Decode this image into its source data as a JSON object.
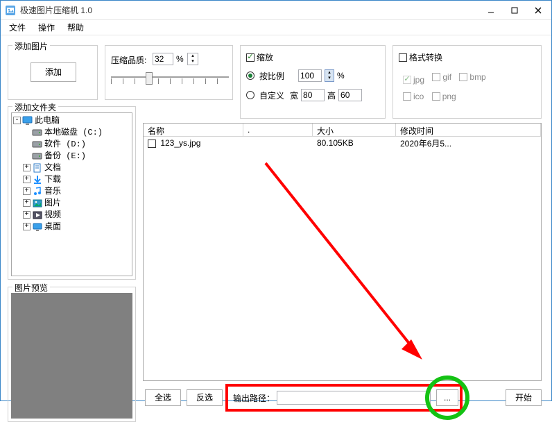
{
  "titlebar": {
    "title": "极速图片压缩机 1.0"
  },
  "menu": {
    "file": "文件",
    "action": "操作",
    "help": "帮助"
  },
  "panels": {
    "add": {
      "legend": "添加图片",
      "button": "添加"
    },
    "quality": {
      "label": "压缩品质:",
      "value": "32",
      "pct": "%"
    },
    "scale": {
      "check_label": "缩放",
      "checked": true,
      "by_ratio_label": "按比例",
      "by_ratio_selected": true,
      "ratio_value": "100",
      "ratio_pct": "%",
      "custom_label": "自定义",
      "custom_selected": false,
      "width_label": "宽",
      "width_value": "80",
      "height_label": "高",
      "height_value": "60"
    },
    "format": {
      "check_label": "格式转换",
      "checked": false,
      "items": [
        "jpg",
        "gif",
        "bmp",
        "ico",
        "png"
      ]
    },
    "tree": {
      "legend": "添加文件夹",
      "root": "此电脑",
      "nodes": [
        {
          "label": "本地磁盘 (C:)",
          "icon": "drive",
          "exp": "none",
          "indent": 2
        },
        {
          "label": "软件 (D:)",
          "icon": "drive",
          "exp": "none",
          "indent": 2
        },
        {
          "label": "备份 (E:)",
          "icon": "drive",
          "exp": "none",
          "indent": 2
        },
        {
          "label": "文档",
          "icon": "doc",
          "exp": "plus",
          "indent": 2
        },
        {
          "label": "下载",
          "icon": "download",
          "exp": "plus",
          "indent": 2
        },
        {
          "label": "音乐",
          "icon": "music",
          "exp": "plus",
          "indent": 2
        },
        {
          "label": "图片",
          "icon": "picture",
          "exp": "plus",
          "indent": 2
        },
        {
          "label": "视频",
          "icon": "video",
          "exp": "plus",
          "indent": 2
        },
        {
          "label": "桌面",
          "icon": "desktop",
          "exp": "plus",
          "indent": 2
        }
      ]
    },
    "preview": {
      "legend": "图片预览"
    }
  },
  "file_list": {
    "columns": {
      "name": "名称",
      "dot": ".",
      "size": "大小",
      "mtime": "修改时间"
    },
    "rows": [
      {
        "checked": false,
        "name": "123_ys.jpg",
        "size": "80.105KB",
        "mtime": "2020年6月5..."
      }
    ]
  },
  "bottom": {
    "select_all": "全选",
    "invert": "反选",
    "output_label": "输出路径：",
    "output_value": "",
    "browse": "...",
    "start": "开始"
  }
}
